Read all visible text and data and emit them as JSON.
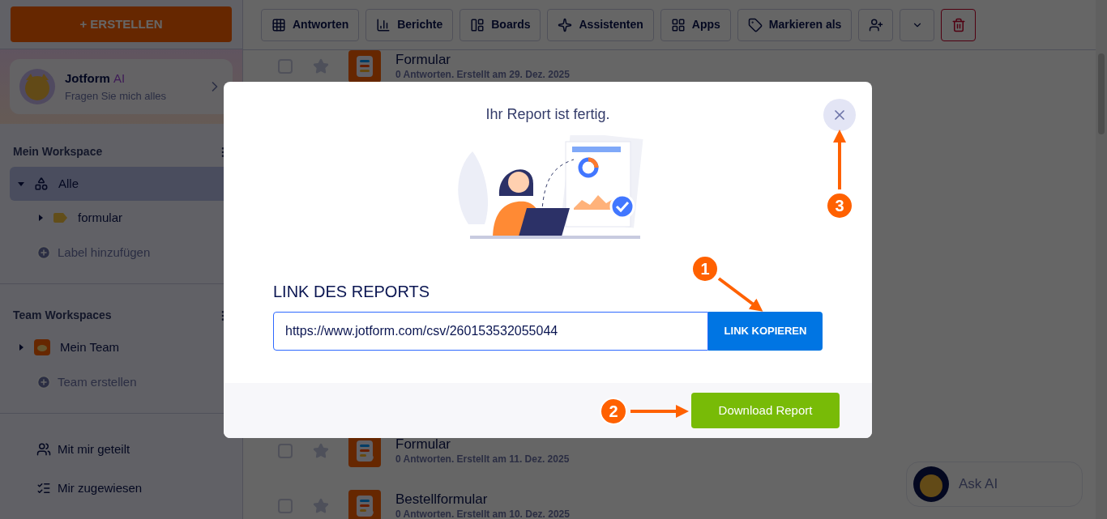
{
  "sidebar": {
    "create_button": "+ ERSTELLEN",
    "ai_card": {
      "title": "Jotform",
      "title_accent": "AI",
      "subtitle": "Fragen Sie mich alles"
    },
    "sections": [
      {
        "heading": "Mein Workspace",
        "items": [
          {
            "label": "Alle",
            "kind": "all",
            "selected": true,
            "expanded": true,
            "children": [
              {
                "label": "formular",
                "kind": "label",
                "selected": false,
                "expanded": false
              }
            ]
          }
        ],
        "add_label": "Label hinzufügen"
      },
      {
        "heading": "Team Workspaces",
        "items": [
          {
            "label": "Mein Team",
            "kind": "team",
            "selected": false,
            "expanded": false
          }
        ],
        "add_label": "Team erstellen"
      }
    ],
    "links": [
      {
        "label": "Mit mir geteilt",
        "kind": "shared"
      },
      {
        "label": "Mir zugewiesen",
        "kind": "assigned"
      }
    ]
  },
  "toolbar": [
    {
      "kind": "responses",
      "label": "Antworten"
    },
    {
      "kind": "reports",
      "label": "Berichte"
    },
    {
      "kind": "boards",
      "label": "Boards"
    },
    {
      "kind": "assistants",
      "label": "Assistenten"
    },
    {
      "kind": "apps",
      "label": "Apps"
    },
    {
      "kind": "mark",
      "label": "Markieren als"
    },
    {
      "kind": "assign"
    },
    {
      "kind": "more"
    },
    {
      "kind": "delete"
    }
  ],
  "forms": [
    {
      "title": "Formular",
      "meta": "0 Antworten. Erstellt am 29. Dez. 2025",
      "kind": "form",
      "checked": false,
      "starred": false
    },
    {
      "title": "Formular",
      "meta": "0 Antworten. Erstellt am 11. Dez. 2025",
      "kind": "payment",
      "checked": false,
      "starred": false
    },
    {
      "title": "Bestellformular",
      "meta": "0 Antworten. Erstellt am 10. Dez. 2025",
      "kind": "payment",
      "checked": false,
      "starred": false
    }
  ],
  "ask_ai": "Ask AI",
  "dialog": {
    "title": "Ihr Report ist fertig.",
    "link_label": "LINK DES REPORTS",
    "link_value": "https://www.jotform.com/csv/260153532055044",
    "copy_button": "LINK KOPIEREN",
    "download_button": "Download Report"
  },
  "annotations": [
    {
      "number": "1"
    },
    {
      "number": "2"
    },
    {
      "number": "3"
    }
  ]
}
